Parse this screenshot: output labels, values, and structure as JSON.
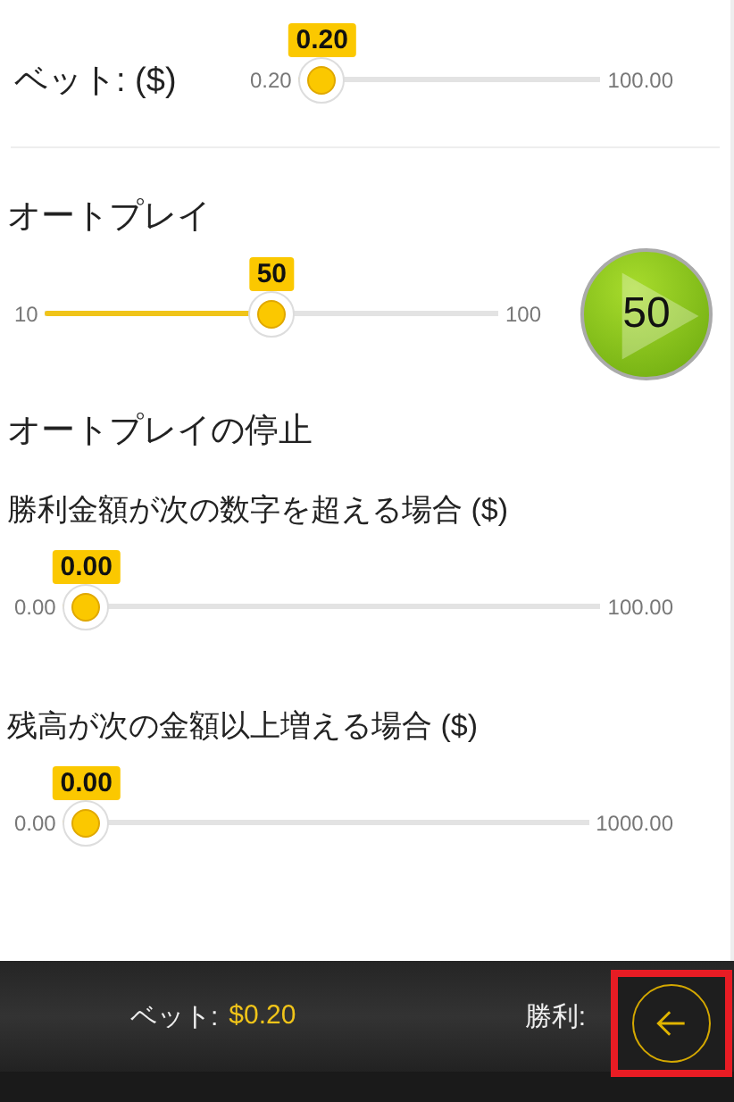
{
  "bet": {
    "label": "ベット: ($)",
    "slider": {
      "min": "0.20",
      "max": "100.00",
      "value": "0.20",
      "level": 0
    }
  },
  "autoplay": {
    "title": "オートプレイ",
    "slider": {
      "min": "10",
      "max": "100",
      "value": "50",
      "level": 0.5
    },
    "play_button": {
      "label": "50"
    }
  },
  "stop_autoplay": {
    "title": "オートプレイの停止",
    "conditions": [
      {
        "label": "勝利金額が次の数字を超える場合 ($)",
        "slider": {
          "min": "0.00",
          "max": "100.00",
          "value": "0.00",
          "level": 0
        }
      },
      {
        "label": "残高が次の金額以上増える場合 ($)",
        "slider": {
          "min": "0.00",
          "max": "1000.00",
          "value": "0.00",
          "level": 0
        }
      }
    ]
  },
  "footer": {
    "bet_label": "ベット:",
    "bet_value": "$0.20",
    "win_label": "勝利:",
    "back_button": {
      "highlighted": true
    }
  }
}
